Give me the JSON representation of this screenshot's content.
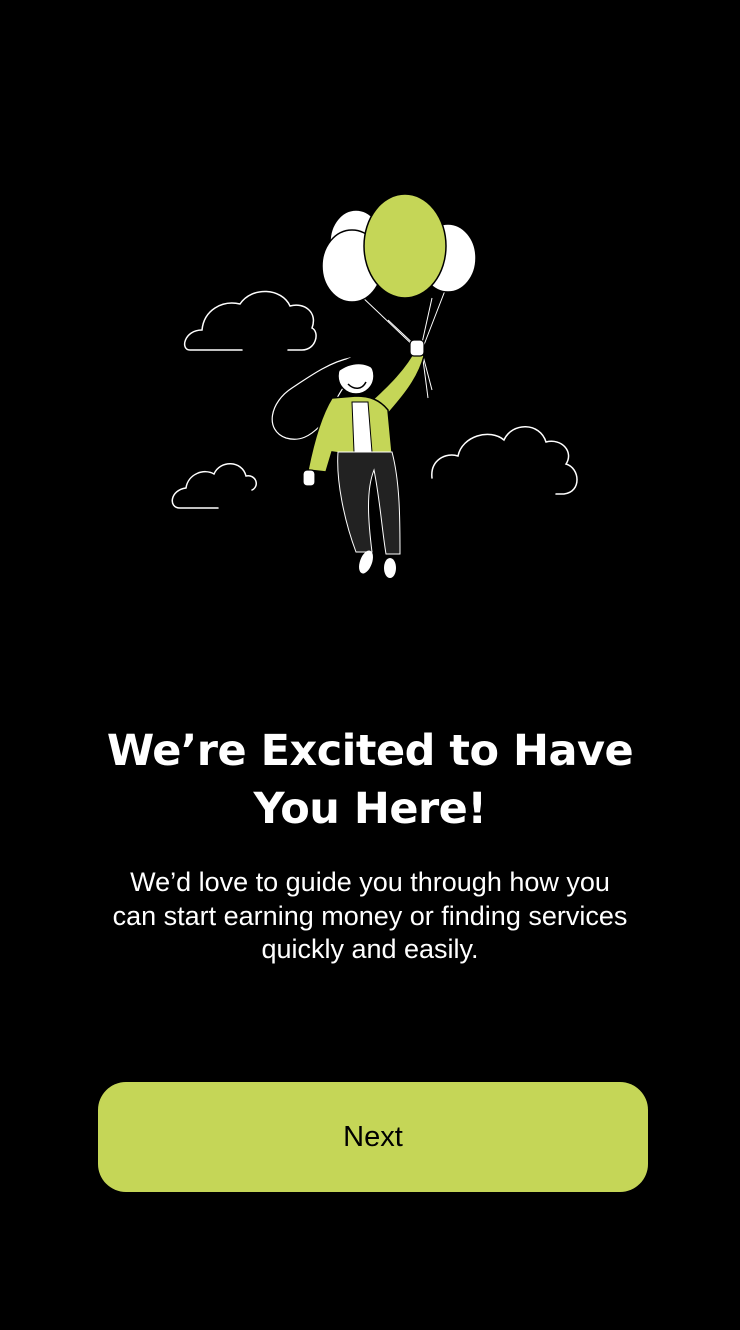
{
  "onboarding": {
    "title": "We’re Excited to Have You Here!",
    "subtitle": "We’d love to guide you through how you can start earning money or finding services quickly and easily.",
    "illustration_icon": "balloon-girl-illustration"
  },
  "actions": {
    "next_label": "Next"
  },
  "theme": {
    "background": "#000000",
    "accent": "#c5d657",
    "text": "#ffffff",
    "button_text": "#000000"
  }
}
